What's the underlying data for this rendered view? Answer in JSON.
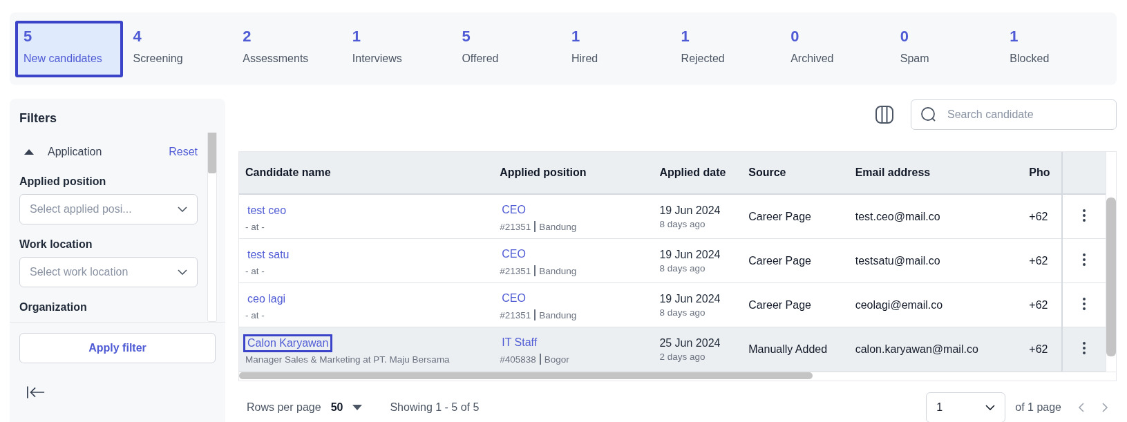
{
  "stages": [
    {
      "count": "5",
      "label": "New candidates",
      "selected": true
    },
    {
      "count": "4",
      "label": "Screening",
      "selected": false
    },
    {
      "count": "2",
      "label": "Assessments",
      "selected": false
    },
    {
      "count": "1",
      "label": "Interviews",
      "selected": false
    },
    {
      "count": "5",
      "label": "Offered",
      "selected": false
    },
    {
      "count": "1",
      "label": "Hired",
      "selected": false
    },
    {
      "count": "1",
      "label": "Rejected",
      "selected": false
    },
    {
      "count": "0",
      "label": "Archived",
      "selected": false
    },
    {
      "count": "0",
      "label": "Spam",
      "selected": false
    },
    {
      "count": "1",
      "label": "Blocked",
      "selected": false
    }
  ],
  "filters": {
    "title": "Filters",
    "section": {
      "label": "Application",
      "expanded": true,
      "reset": "Reset"
    },
    "fields": [
      {
        "label": "Applied position",
        "placeholder": "Select applied posi..."
      },
      {
        "label": "Work location",
        "placeholder": "Select work location"
      }
    ],
    "cut_label": "Organization",
    "apply": "Apply filter"
  },
  "search": {
    "placeholder": "Search candidate"
  },
  "table": {
    "columns": [
      "Candidate name",
      "Applied position",
      "Applied date",
      "Source",
      "Email address",
      "Pho"
    ],
    "rows": [
      {
        "name": "test ceo",
        "company": "- at -",
        "position": "CEO",
        "job_id": "#21351",
        "location": "Bandung",
        "date": "19 Jun 2024",
        "ago": "8 days ago",
        "source": "Career Page",
        "email": "test.ceo@mail.co",
        "phone": "+62",
        "selected": false
      },
      {
        "name": "test satu",
        "company": "- at -",
        "position": "CEO",
        "job_id": "#21351",
        "location": "Bandung",
        "date": "19 Jun 2024",
        "ago": "8 days ago",
        "source": "Career Page",
        "email": "testsatu@mail.co",
        "phone": "+62",
        "selected": false
      },
      {
        "name": "ceo lagi",
        "company": "- at -",
        "position": "CEO",
        "job_id": "#21351",
        "location": "Bandung",
        "date": "19 Jun 2024",
        "ago": "8 days ago",
        "source": "Career Page",
        "email": "ceolagi@email.co",
        "phone": "+62",
        "selected": false
      },
      {
        "name": "Calon Karyawan",
        "company": "Manager Sales & Marketing at PT. Maju Bersama",
        "position": "IT Staff",
        "job_id": "#405838",
        "location": "Bogor",
        "date": "25 Jun 2024",
        "ago": "2 days ago",
        "source": "Manually Added",
        "email": "calon.karyawan@mail.co",
        "phone": "+62",
        "selected": true
      }
    ]
  },
  "footer": {
    "rows_label": "Rows per page",
    "rows_value": "50",
    "showing": "Showing 1 - 5 of 5",
    "page": "1",
    "page_total": "of 1 page"
  }
}
